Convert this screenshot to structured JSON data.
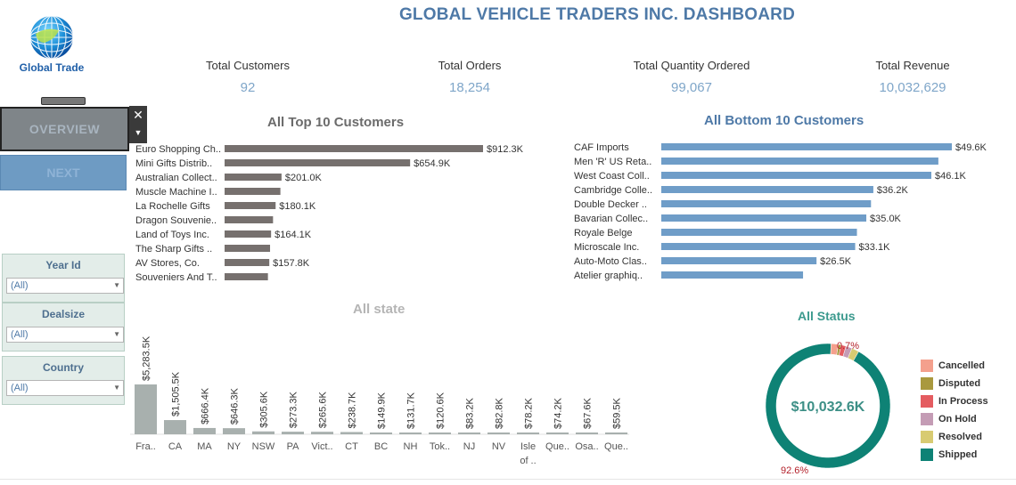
{
  "header": {
    "title": "GLOBAL VEHICLE TRADERS INC. DASHBOARD",
    "logo_text": "Global Trade"
  },
  "kpis": [
    {
      "label": "Total Customers",
      "value": "92"
    },
    {
      "label": "Total Orders",
      "value": "18,254"
    },
    {
      "label": "Total Quantity Ordered",
      "value": "99,067"
    },
    {
      "label": "Total Revenue",
      "value": "10,032,629"
    }
  ],
  "nav": {
    "overview_label": "OVERVIEW",
    "next_label": "NEXT",
    "close_icon": "close-icon",
    "dropdown_icon": "chevron-down-icon"
  },
  "filters": [
    {
      "title": "Year Id",
      "value": "(All)"
    },
    {
      "title": "Dealsize",
      "value": "(All)"
    },
    {
      "title": "Country",
      "value": "(All)"
    }
  ],
  "colors": {
    "title": "#4e79a7",
    "top_bar": "#76706e",
    "bottom_bar": "#6f9dc8",
    "state_bar": "#a8b0ae",
    "donut_main": "#0e8275",
    "kpi_value": "#7fa6c9"
  },
  "chart_data": [
    {
      "type": "bar",
      "orientation": "horizontal",
      "title": "All Top 10 Customers",
      "categories": [
        "Euro Shopping Ch..",
        "Mini Gifts Distrib..",
        "Australian Collect..",
        "Muscle Machine I..",
        "La Rochelle Gifts",
        "Dragon Souvenie..",
        "Land of Toys Inc.",
        "The Sharp Gifts ..",
        "AV Stores, Co.",
        "Souveniers And T.."
      ],
      "values": [
        912.3,
        654.9,
        201.0,
        197.0,
        180.1,
        171.0,
        164.1,
        160.5,
        157.8,
        153.0
      ],
      "labels": [
        "$912.3K",
        "$654.9K",
        "$201.0K",
        "",
        "$180.1K",
        "",
        "$164.1K",
        "",
        "$157.8K",
        ""
      ]
    },
    {
      "type": "bar",
      "orientation": "horizontal",
      "title": "All Bottom 10 Customers",
      "categories": [
        "CAF Imports",
        "Men 'R' US Reta..",
        "West Coast Coll..",
        "Cambridge Colle..",
        "Double Decker ..",
        "Bavarian Collec..",
        "Royale Belge",
        "Microscale Inc.",
        "Auto-Moto Clas..",
        "Atelier graphiq.."
      ],
      "values": [
        49.6,
        47.3,
        46.1,
        36.2,
        35.8,
        35.0,
        33.4,
        33.1,
        26.5,
        24.2
      ],
      "labels": [
        "$49.6K",
        "",
        "$46.1K",
        "$36.2K",
        "",
        "$35.0K",
        "",
        "$33.1K",
        "$26.5K",
        ""
      ]
    },
    {
      "type": "bar",
      "title": "All state",
      "categories": [
        "Fra..",
        "CA",
        "MA",
        "NY",
        "NSW",
        "PA",
        "Vict..",
        "CT",
        "BC",
        "NH",
        "Tok..",
        "NJ",
        "NV",
        "Isle of ..",
        "Que..",
        "Osa..",
        "Que.."
      ],
      "values": [
        5283.5,
        1505.5,
        666.4,
        646.3,
        305.6,
        273.3,
        265.6,
        238.7,
        149.9,
        131.7,
        120.6,
        83.2,
        82.8,
        78.2,
        74.2,
        67.6,
        59.5
      ],
      "labels": [
        "$5,283.5K",
        "$1,505.5K",
        "$666.4K",
        "$646.3K",
        "$305.6K",
        "$273.3K",
        "$265.6K",
        "$238.7K",
        "$149.9K",
        "$131.7K",
        "$120.6K",
        "$83.2K",
        "$82.8K",
        "$78.2K",
        "$74.2K",
        "$67.6K",
        "$59.5K"
      ]
    },
    {
      "type": "pie",
      "title": "All Status",
      "center_label": "$10,032.6K",
      "slices": [
        {
          "name": "Cancelled",
          "value": 1.9,
          "color": "#f4a08d"
        },
        {
          "name": "Disputed",
          "value": 0.7,
          "color": "#a9993e"
        },
        {
          "name": "In Process",
          "value": 1.3,
          "color": "#e45c60"
        },
        {
          "name": "On Hold",
          "value": 1.6,
          "color": "#c49cb5"
        },
        {
          "name": "Resolved",
          "value": 1.9,
          "color": "#d8cb72"
        },
        {
          "name": "Shipped",
          "value": 92.6,
          "color": "#0e8275"
        }
      ],
      "data_labels": [
        "0.7%",
        "92.6%"
      ]
    }
  ]
}
